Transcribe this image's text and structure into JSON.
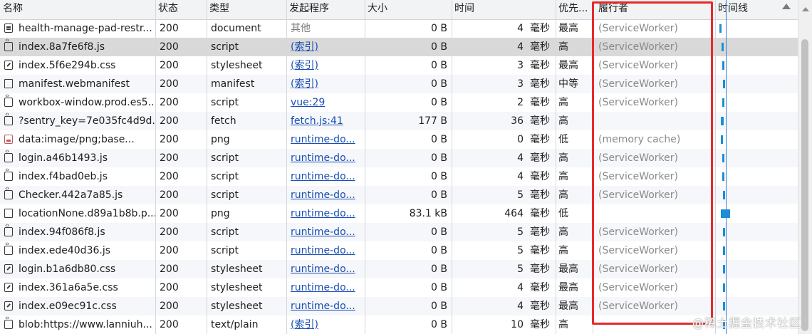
{
  "headers": {
    "name": "名称",
    "status": "状态",
    "type": "类型",
    "initiator": "发起程序",
    "size": "大小",
    "time": "时间",
    "priority": "优先...",
    "fulfilled_by": "履行者",
    "waterfall": "时间线"
  },
  "rows": [
    {
      "name": "health-manage-pad-restr...",
      "status": "200",
      "type": "document",
      "initiator": "其他",
      "initiator_link": false,
      "size": "0 B",
      "time": "4",
      "unit": "毫秒",
      "priority": "最高",
      "fulfilled": "(ServiceWorker)",
      "icon": "document-icon"
    },
    {
      "name": "index.8a7fe6f8.js",
      "status": "200",
      "type": "script",
      "initiator": "(索引)",
      "initiator_link": true,
      "size": "0 B",
      "time": "4",
      "unit": "毫秒",
      "priority": "高",
      "fulfilled": "(ServiceWorker)",
      "icon": "script-icon"
    },
    {
      "name": "index.5f6e294b.css",
      "status": "200",
      "type": "stylesheet",
      "initiator": "(索引)",
      "initiator_link": true,
      "size": "0 B",
      "time": "3",
      "unit": "毫秒",
      "priority": "最高",
      "fulfilled": "(ServiceWorker)",
      "icon": "stylesheet-icon"
    },
    {
      "name": "manifest.webmanifest",
      "status": "200",
      "type": "manifest",
      "initiator": "(索引)",
      "initiator_link": true,
      "size": "0 B",
      "time": "3",
      "unit": "毫秒",
      "priority": "中等",
      "fulfilled": "(ServiceWorker)",
      "icon": "manifest-icon"
    },
    {
      "name": "workbox-window.prod.es5...",
      "status": "200",
      "type": "script",
      "initiator": "vue:29",
      "initiator_link": true,
      "size": "0 B",
      "time": "2",
      "unit": "毫秒",
      "priority": "高",
      "fulfilled": "(ServiceWorker)",
      "icon": "script-icon"
    },
    {
      "name": "?sentry_key=7e035fc4d9d...",
      "status": "200",
      "type": "fetch",
      "initiator": "fetch.js:41",
      "initiator_link": true,
      "size": "177 B",
      "time": "36",
      "unit": "毫秒",
      "priority": "高",
      "fulfilled": "",
      "icon": "fetch-icon"
    },
    {
      "name": "data:image/png;base...",
      "status": "200",
      "type": "png",
      "initiator": "runtime-do...",
      "initiator_link": true,
      "size": "0 B",
      "time": "0",
      "unit": "毫秒",
      "priority": "低",
      "fulfilled": "(memory cache)",
      "icon": "image-icon"
    },
    {
      "name": "login.a46b1493.js",
      "status": "200",
      "type": "script",
      "initiator": "runtime-do...",
      "initiator_link": true,
      "size": "0 B",
      "time": "4",
      "unit": "毫秒",
      "priority": "高",
      "fulfilled": "(ServiceWorker)",
      "icon": "script-icon"
    },
    {
      "name": "index.f4bad0eb.js",
      "status": "200",
      "type": "script",
      "initiator": "runtime-do...",
      "initiator_link": true,
      "size": "0 B",
      "time": "4",
      "unit": "毫秒",
      "priority": "高",
      "fulfilled": "(ServiceWorker)",
      "icon": "script-icon"
    },
    {
      "name": "Checker.442a7a85.js",
      "status": "200",
      "type": "script",
      "initiator": "runtime-do...",
      "initiator_link": true,
      "size": "0 B",
      "time": "5",
      "unit": "毫秒",
      "priority": "高",
      "fulfilled": "(ServiceWorker)",
      "icon": "script-icon"
    },
    {
      "name": "locationNone.d89a1b8b.p...",
      "status": "200",
      "type": "png",
      "initiator": "runtime-do...",
      "initiator_link": true,
      "size": "83.1 kB",
      "time": "464",
      "unit": "毫秒",
      "priority": "低",
      "fulfilled": "",
      "icon": "file-icon"
    },
    {
      "name": "index.94f086f8.js",
      "status": "200",
      "type": "script",
      "initiator": "runtime-do...",
      "initiator_link": true,
      "size": "0 B",
      "time": "5",
      "unit": "毫秒",
      "priority": "高",
      "fulfilled": "(ServiceWorker)",
      "icon": "script-icon"
    },
    {
      "name": "index.ede40d36.js",
      "status": "200",
      "type": "script",
      "initiator": "runtime-do...",
      "initiator_link": true,
      "size": "0 B",
      "time": "5",
      "unit": "毫秒",
      "priority": "高",
      "fulfilled": "(ServiceWorker)",
      "icon": "script-icon"
    },
    {
      "name": "login.b1a6db80.css",
      "status": "200",
      "type": "stylesheet",
      "initiator": "runtime-do...",
      "initiator_link": true,
      "size": "0 B",
      "time": "5",
      "unit": "毫秒",
      "priority": "最高",
      "fulfilled": "(ServiceWorker)",
      "icon": "stylesheet-icon"
    },
    {
      "name": "index.361a6a5e.css",
      "status": "200",
      "type": "stylesheet",
      "initiator": "runtime-do...",
      "initiator_link": true,
      "size": "0 B",
      "time": "4",
      "unit": "毫秒",
      "priority": "最高",
      "fulfilled": "(ServiceWorker)",
      "icon": "stylesheet-icon"
    },
    {
      "name": "index.e09ec91c.css",
      "status": "200",
      "type": "stylesheet",
      "initiator": "runtime-do...",
      "initiator_link": true,
      "size": "0 B",
      "time": "4",
      "unit": "毫秒",
      "priority": "最高",
      "fulfilled": "(ServiceWorker)",
      "icon": "stylesheet-icon"
    },
    {
      "name": "blob:https://www.lanniuh...",
      "status": "200",
      "type": "text/plain",
      "initiator": "(索引)",
      "initiator_link": true,
      "size": "0 B",
      "time": "10",
      "unit": "毫秒",
      "priority": "高",
      "fulfilled": "",
      "icon": "script-icon"
    }
  ],
  "selected_row": 1,
  "watermark": "@稀土掘金技术社区",
  "colors": {
    "highlight_border": "#e8292b",
    "link": "#1a4fb4",
    "waterfall_bar": "#1a8fd6",
    "selected_row": "#d9d9d9"
  }
}
